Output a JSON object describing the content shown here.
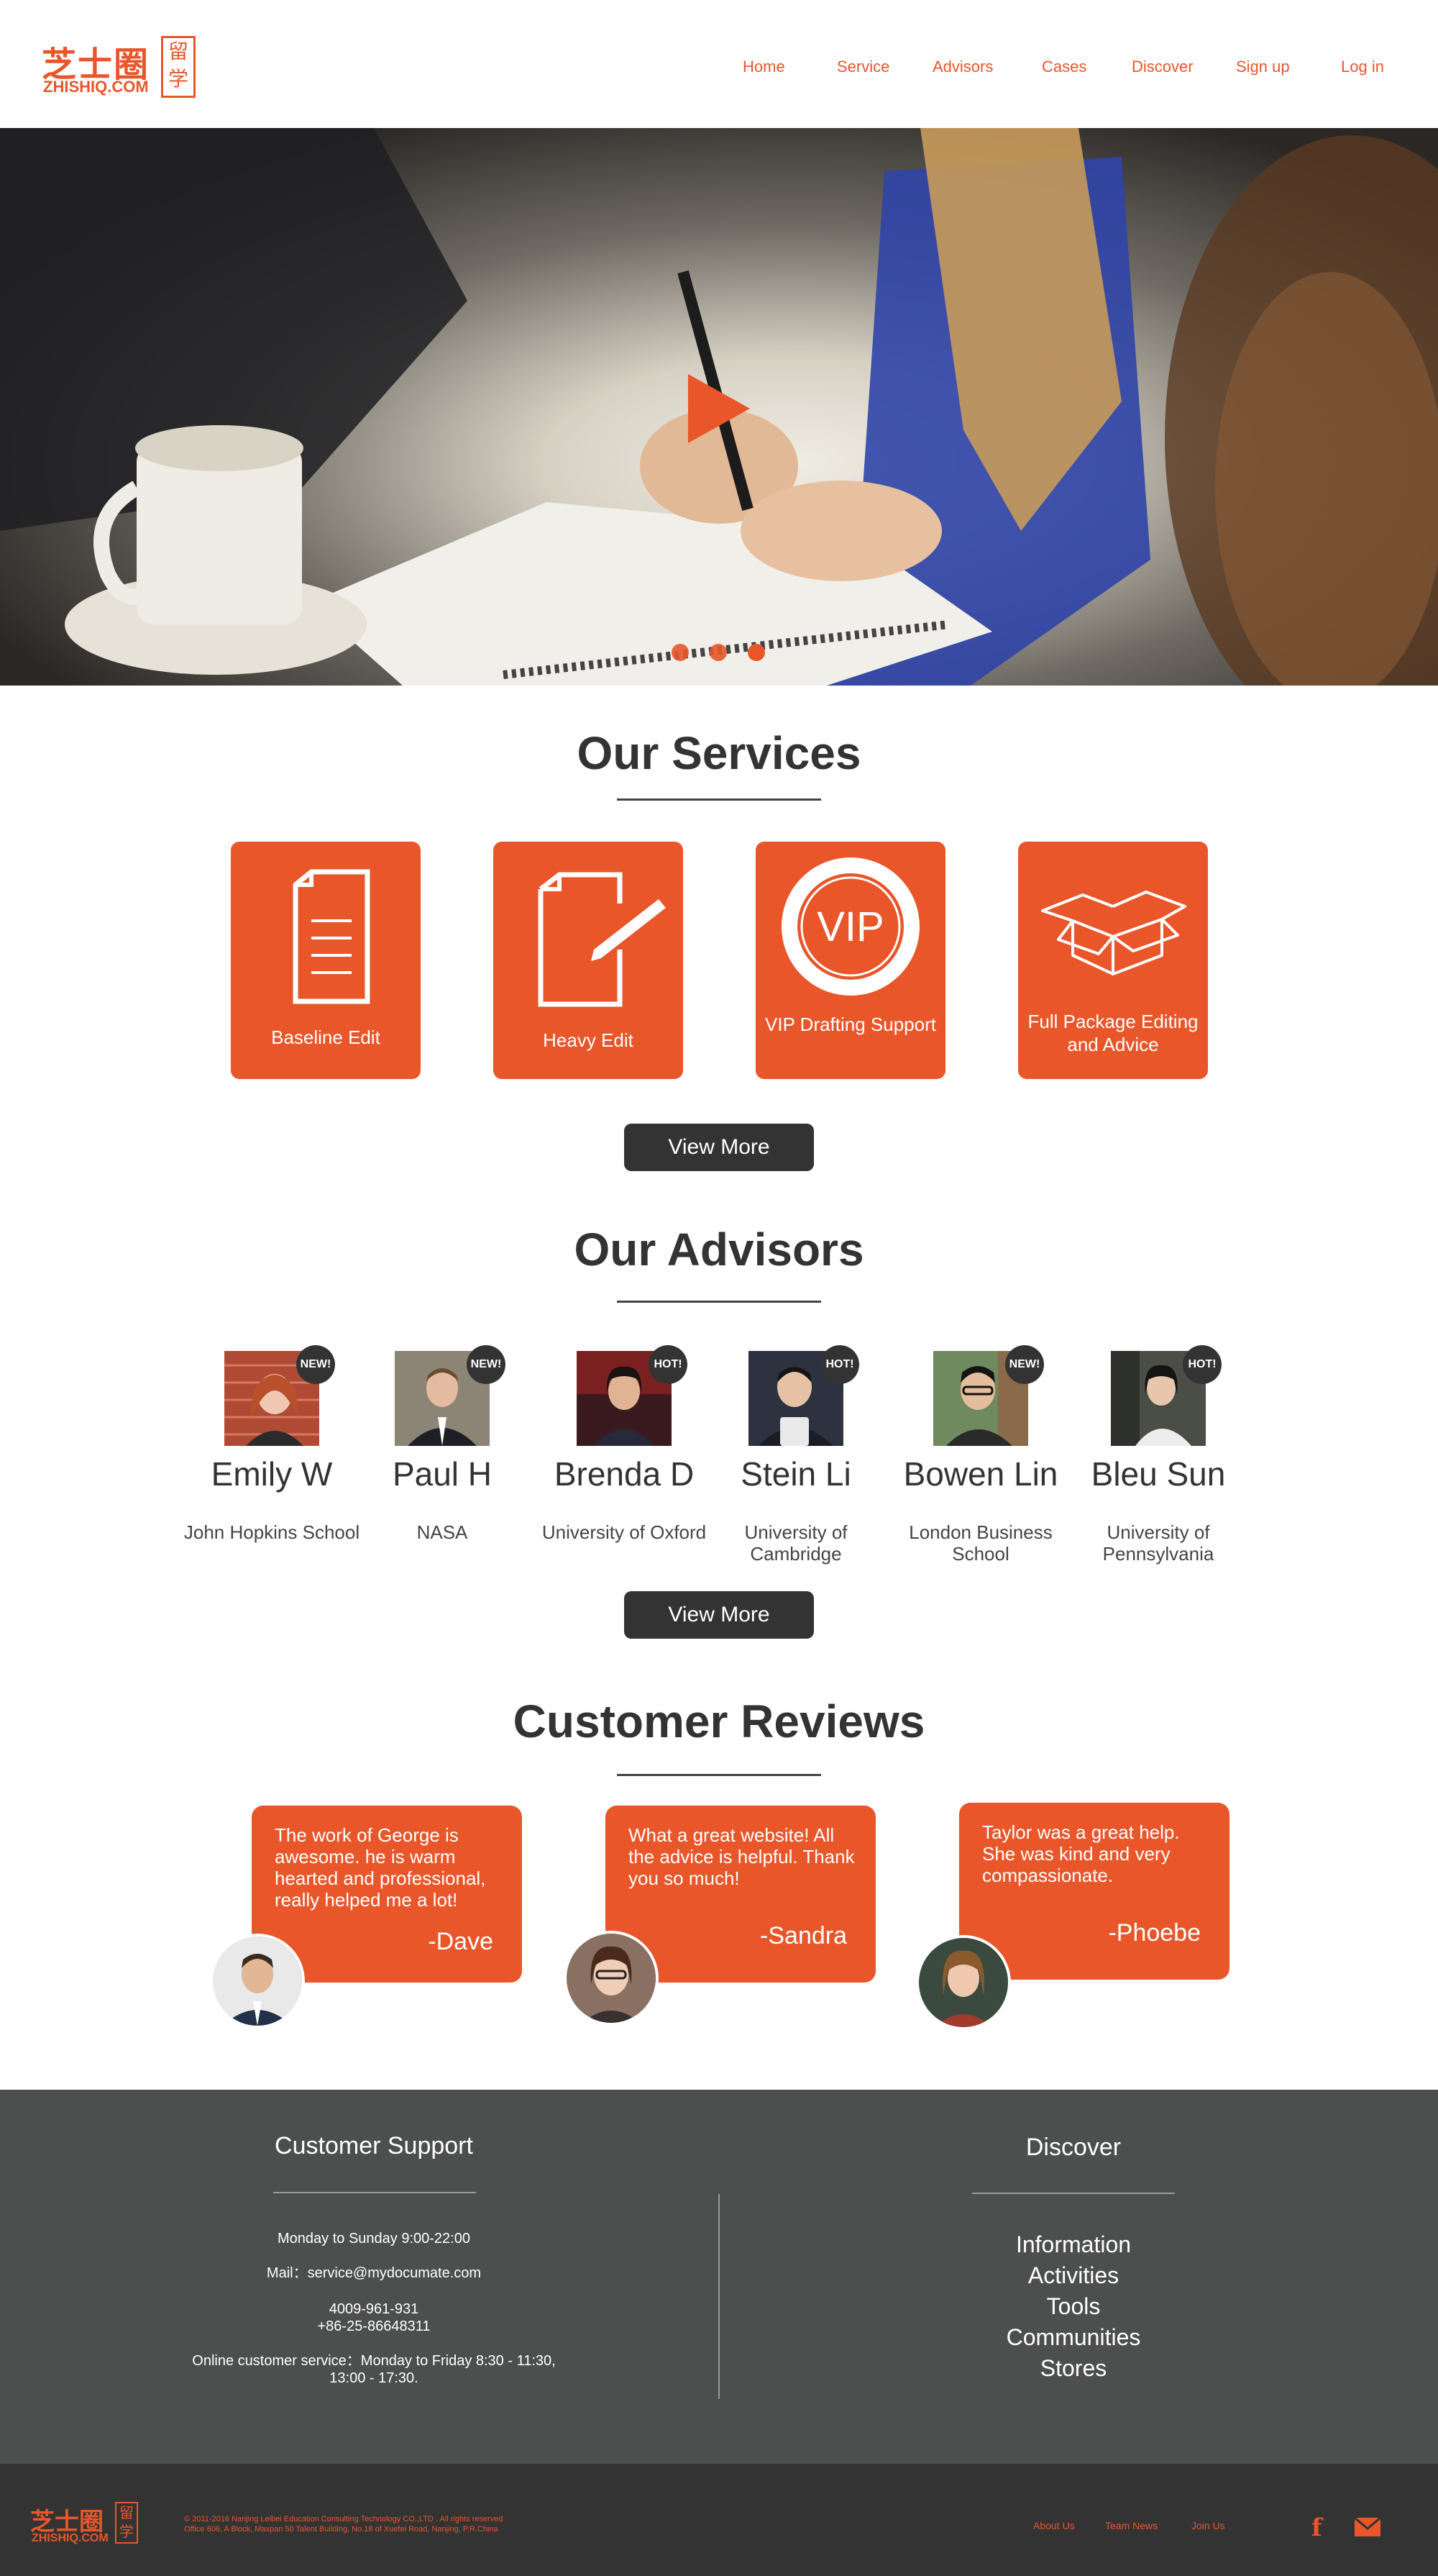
{
  "brand": {
    "logo_cn": "芝士圈",
    "logo_en": "ZHISHIQ.COM",
    "seal": "留学",
    "accent": "#e8562a",
    "dark": "#333333"
  },
  "nav": {
    "items": [
      "Home",
      "Service",
      "Advisors",
      "Cases",
      "Discover",
      "Sign up",
      "Log in"
    ]
  },
  "hero": {
    "slide_count": 3,
    "active_slide": 3
  },
  "services": {
    "title": "Our Services",
    "cards": [
      {
        "label": "Baseline Edit",
        "icon": "document-icon"
      },
      {
        "label": "Heavy Edit",
        "icon": "edit-document-icon"
      },
      {
        "label": "VIP Drafting Support",
        "icon": "vip-seal-icon",
        "icon_text": "VIP"
      },
      {
        "label": "Full Package Editing and Advice",
        "icon": "open-box-icon"
      }
    ],
    "view_more": "View More"
  },
  "advisors": {
    "title": "Our Advisors",
    "items": [
      {
        "name": "Emily W",
        "school": "John Hopkins School",
        "badge": "NEW!"
      },
      {
        "name": "Paul H",
        "school": "NASA",
        "badge": "NEW!"
      },
      {
        "name": "Brenda D",
        "school": "University of Oxford",
        "badge": "HOT!"
      },
      {
        "name": "Stein Li",
        "school": "University of Cambridge",
        "badge": "HOT!"
      },
      {
        "name": "Bowen Lin",
        "school": "London Business School",
        "badge": "NEW!"
      },
      {
        "name": "Bleu Sun",
        "school": "University of Pennsylvania",
        "badge": "HOT!"
      }
    ],
    "view_more": "View More"
  },
  "reviews": {
    "title": "Customer Reviews",
    "items": [
      {
        "text": "The work of George is awesome. he is warm hearted and professional, really helped me a lot!",
        "author": "-Dave"
      },
      {
        "text": "What a great website! All the advice is helpful. Thank you so much!",
        "author": "-Sandra"
      },
      {
        "text": "Taylor was a great help. She was kind and very compassionate.",
        "author": "-Phoebe"
      }
    ]
  },
  "footer": {
    "support": {
      "title": "Customer Support",
      "hours": "Monday to Sunday 9:00-22:00",
      "mail": "Mail：service@mydocumate.com",
      "phone1": "4009-961-931",
      "phone2": "+86-25-86648311",
      "online": "Online customer service：Monday to Friday 8:30 - 11:30, 13:00 - 17:30."
    },
    "discover": {
      "title": "Discover",
      "links": [
        "Information",
        "Activities",
        "Tools",
        "Communities",
        "Stores"
      ]
    }
  },
  "bottom": {
    "copyright": "© 2011-2016 Nanjing Leibei Education Consulting Technology CO.,LTD . All rights reserved",
    "address": "Office 606, A Block, Maxpan 50 Talent Building, No.18 of Xuefei Road, Nanjing, P.R.China",
    "links": [
      "About Us",
      "Team News",
      "Join Us"
    ],
    "social": [
      "facebook-icon",
      "mail-icon"
    ]
  }
}
